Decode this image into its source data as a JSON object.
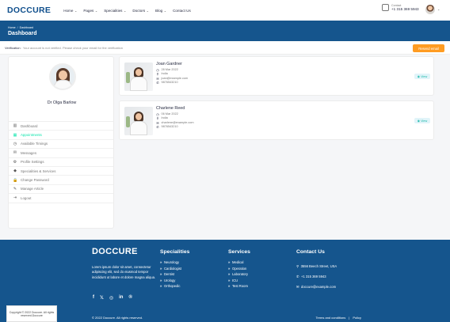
{
  "header": {
    "logo": "DOCCURE",
    "nav": [
      {
        "label": "Home"
      },
      {
        "label": "Pages"
      },
      {
        "label": "Specialities"
      },
      {
        "label": "Doctors"
      },
      {
        "label": "Blog"
      },
      {
        "label": "Contact Us",
        "no_chevron": true
      }
    ],
    "contact_label": "Contact",
    "contact_phone": "+1 315 369 5943"
  },
  "breadcrumb": {
    "home": "Home",
    "current": "Dashboard",
    "title": "Dashboard"
  },
  "verification": {
    "label": "Verification",
    "message": " : Your account is not verified. Please check your email for the verification",
    "button": "Resend email"
  },
  "profile": {
    "name": "Dr Olga Barlow"
  },
  "sidebar": {
    "items": [
      {
        "label": "Dashboard",
        "icon": "dashboard-icon",
        "glyph": "▥",
        "active": false
      },
      {
        "label": "Appointments",
        "icon": "calendar-icon",
        "glyph": "▦",
        "active": true
      },
      {
        "label": "Available Timings",
        "icon": "clock-icon",
        "glyph": "◷",
        "active": false
      },
      {
        "label": "Messages",
        "icon": "comments-icon",
        "glyph": "✉",
        "active": false
      },
      {
        "label": "Profile Settings",
        "icon": "user-cog-icon",
        "glyph": "⚙",
        "active": false
      },
      {
        "label": "Specialities & Services",
        "icon": "briefcase-icon",
        "glyph": "◆",
        "active": false
      },
      {
        "label": "Change Password",
        "icon": "lock-icon",
        "glyph": "🔒",
        "active": false
      },
      {
        "label": "Manage Article",
        "icon": "pencil-icon",
        "glyph": "✎",
        "active": false
      },
      {
        "label": "Logout",
        "icon": "logout-icon",
        "glyph": "⇥",
        "active": false
      }
    ]
  },
  "appointments": [
    {
      "name": "Joan Gardner",
      "date": "28 Mar 2022",
      "location": "India",
      "email": "joan@example.com",
      "phone": "9876543210",
      "view_label": "View"
    },
    {
      "name": "Charlene Reed",
      "date": "06 Mar 2022",
      "location": "India",
      "email": "charlene@example.com",
      "phone": "9876543210",
      "view_label": "View"
    }
  ],
  "footer": {
    "logo": "DOCCURE",
    "description": "Lorem ipsum dolor sit amet, consectetur adipiscing elit, sed do eiusmod tempor incididunt ut labore et dolore magna aliqua.",
    "social": [
      "f",
      "𝕏",
      "◎",
      "in",
      "®"
    ],
    "specialities": {
      "title": "Specialities",
      "links": [
        "Neurology",
        "Cardiologist",
        "Dentist",
        "Urology",
        "Orthopedic"
      ]
    },
    "services": {
      "title": "Services",
      "links": [
        "Medical",
        "Operation",
        "Laboratory",
        "ICU",
        "Test Room"
      ]
    },
    "contact": {
      "title": "Contact Us",
      "address": "3556 Beech Street, USA",
      "phone": "+1 315 369 5943",
      "email": "doccure@example.com"
    },
    "copyright": "© 2022 Doccure. All rights reserved.",
    "terms": "Terms and conditions",
    "separator": "|",
    "policy": "Policy"
  },
  "copybox": {
    "line1": "Copyright © 2022 Doccure. All rights",
    "line2": "reserved.Doccure"
  },
  "colors": {
    "primary": "#15558d",
    "accent": "#09e5ab",
    "warning": "#ff9c22"
  }
}
